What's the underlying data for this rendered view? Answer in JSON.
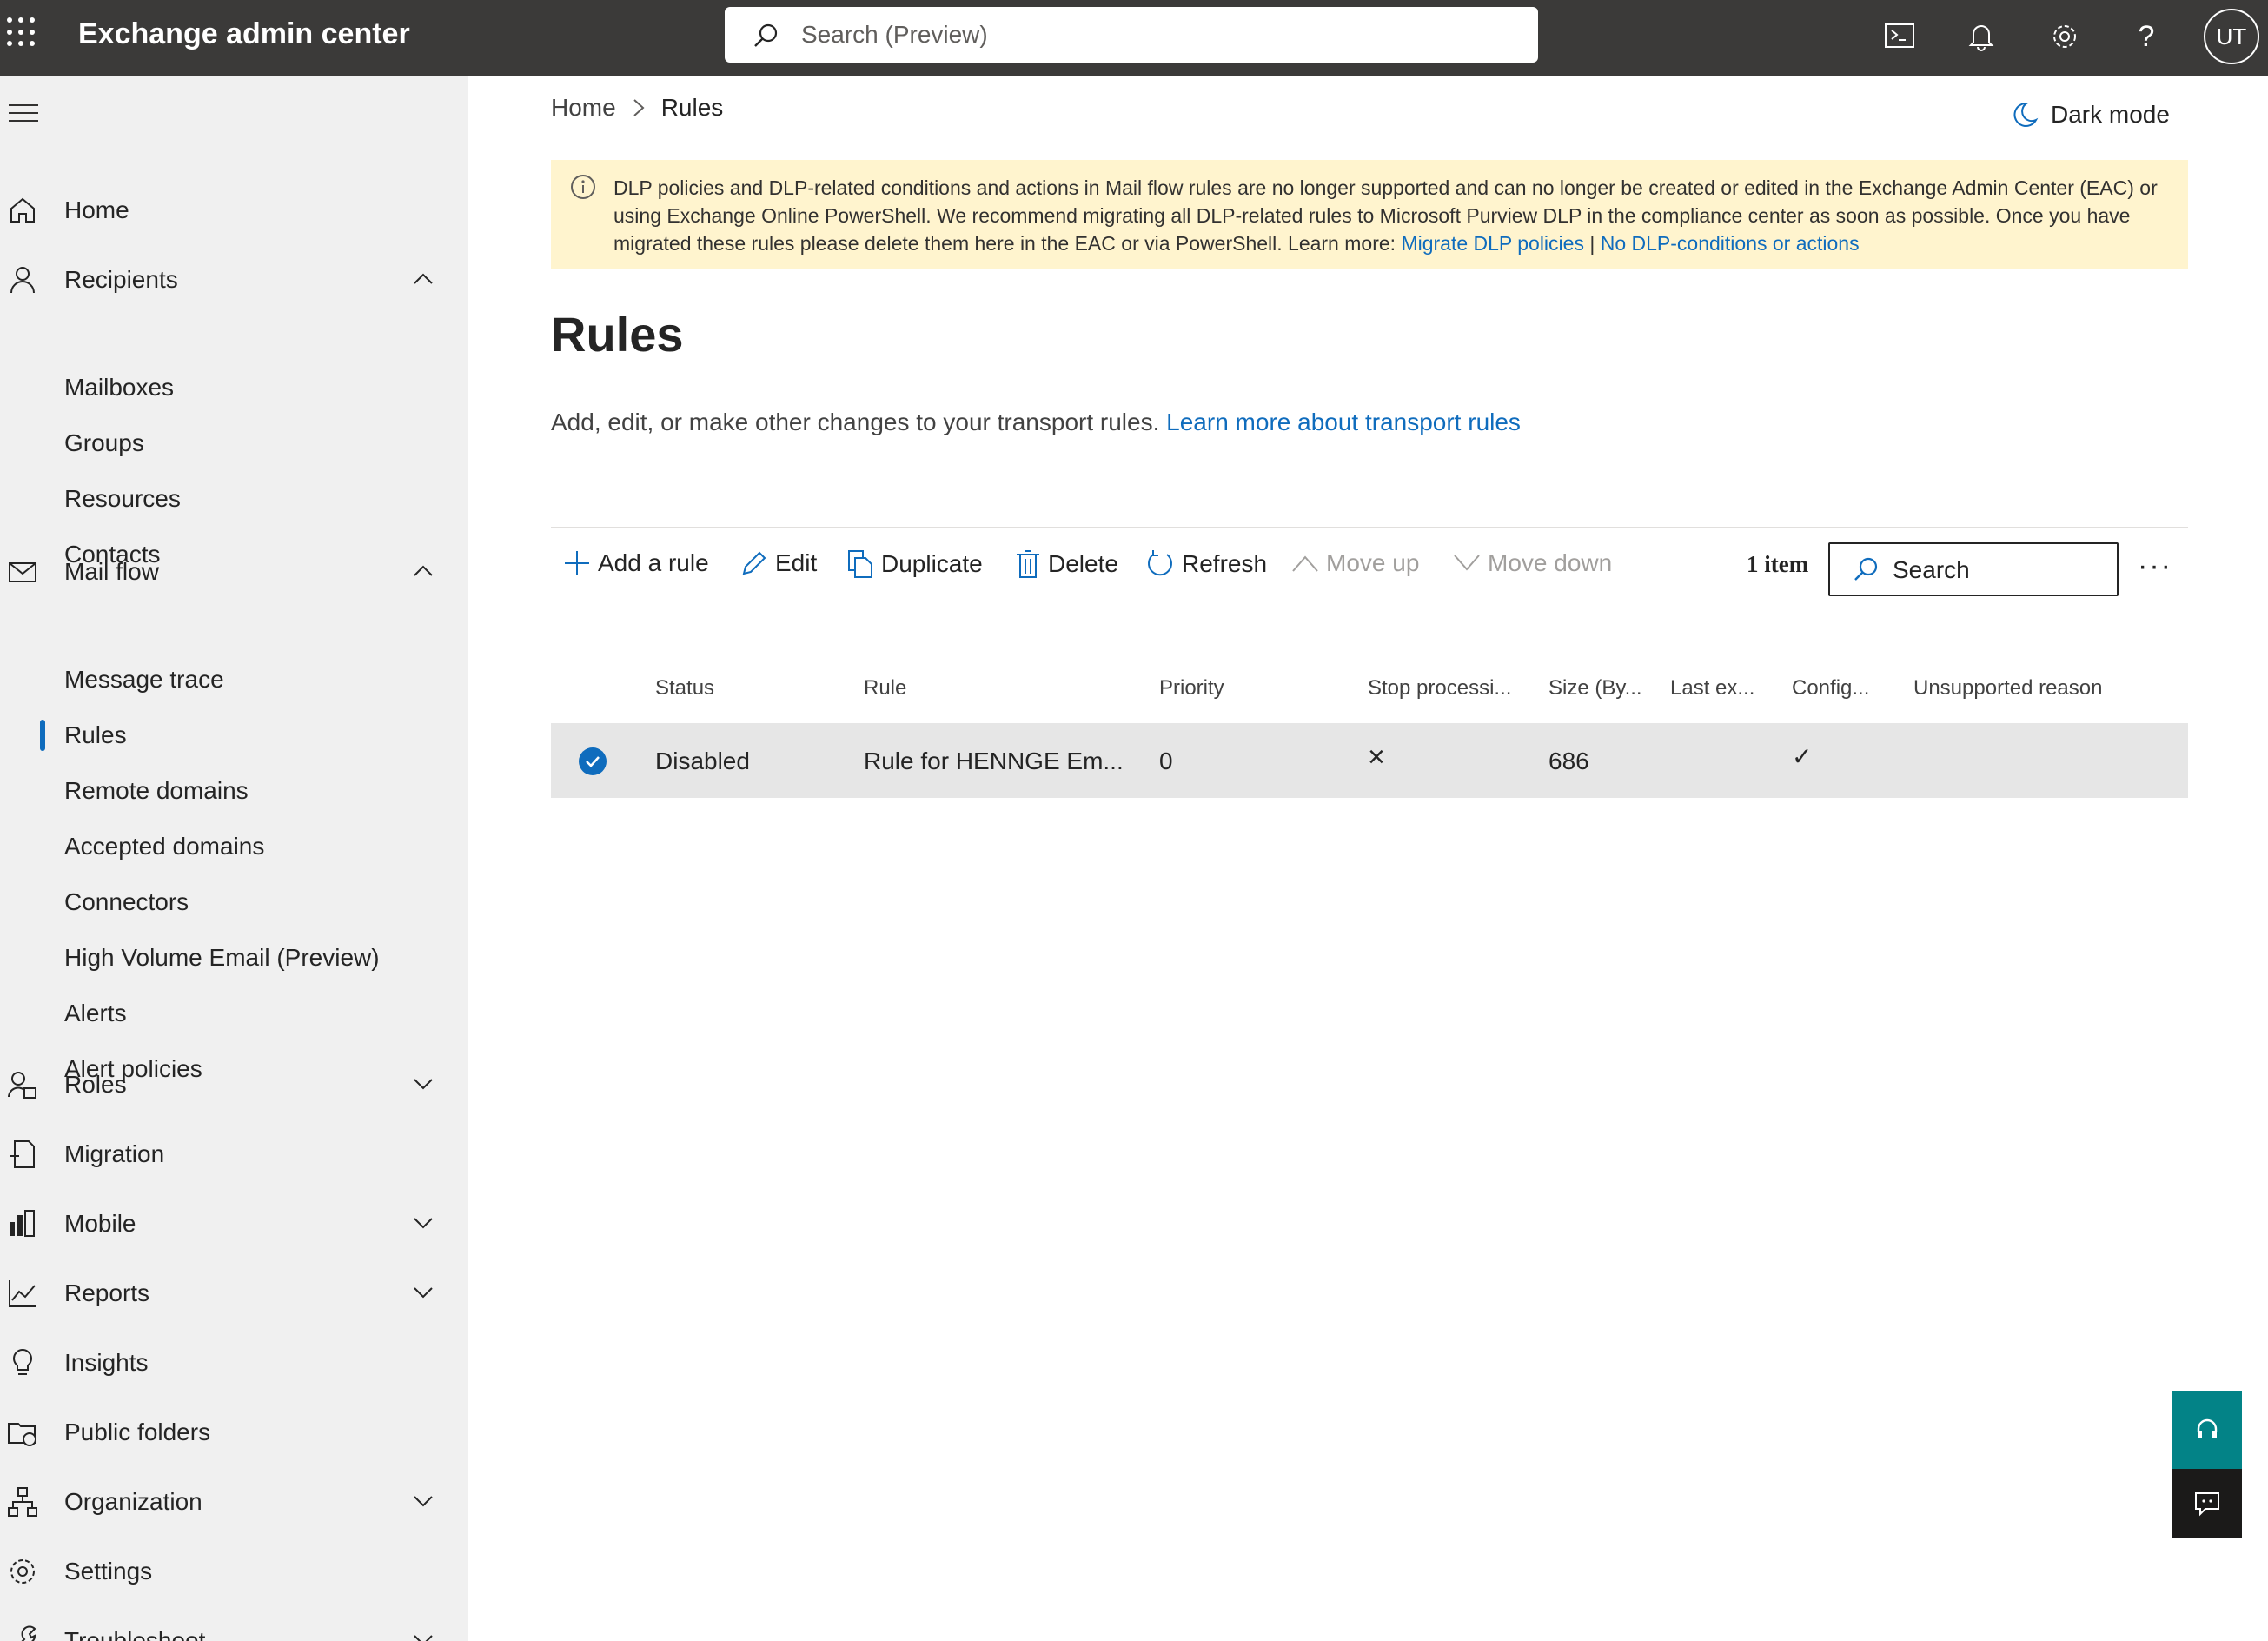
{
  "header": {
    "app_title": "Exchange admin center",
    "search_placeholder": "Search (Preview)",
    "avatar_initials": "UT"
  },
  "sidebar": {
    "items": [
      {
        "label": "Home"
      },
      {
        "label": "Recipients"
      },
      {
        "label": "Mailboxes"
      },
      {
        "label": "Groups"
      },
      {
        "label": "Resources"
      },
      {
        "label": "Contacts"
      },
      {
        "label": "Mail flow"
      },
      {
        "label": "Message trace"
      },
      {
        "label": "Rules"
      },
      {
        "label": "Remote domains"
      },
      {
        "label": "Accepted domains"
      },
      {
        "label": "Connectors"
      },
      {
        "label": "High Volume Email (Preview)"
      },
      {
        "label": "Alerts"
      },
      {
        "label": "Alert policies"
      },
      {
        "label": "Roles"
      },
      {
        "label": "Migration"
      },
      {
        "label": "Mobile"
      },
      {
        "label": "Reports"
      },
      {
        "label": "Insights"
      },
      {
        "label": "Public folders"
      },
      {
        "label": "Organization"
      },
      {
        "label": "Settings"
      },
      {
        "label": "Troubleshoot"
      }
    ]
  },
  "breadcrumb": {
    "home": "Home",
    "current": "Rules"
  },
  "dark_mode_label": "Dark mode",
  "banner": {
    "text": "DLP policies and DLP-related conditions and actions in Mail flow rules are no longer supported and can no longer be created or edited in the Exchange Admin Center (EAC) or using Exchange Online PowerShell. We recommend migrating all DLP-related rules to Microsoft Purview DLP in the compliance center as soon as possible. Once you have migrated these rules please delete them here in the EAC or via PowerShell. Learn more: ",
    "link1": "Migrate DLP policies",
    "separator": " | ",
    "link2": "No DLP-conditions or actions"
  },
  "page": {
    "title": "Rules",
    "description": "Add, edit, or make other changes to your transport rules. ",
    "learn_more": "Learn more about transport rules"
  },
  "toolbar": {
    "add": "Add a rule",
    "edit": "Edit",
    "duplicate": "Duplicate",
    "delete": "Delete",
    "refresh": "Refresh",
    "move_up": "Move up",
    "move_down": "Move down",
    "item_count": "1 item",
    "search_placeholder": "Search",
    "more": "···"
  },
  "table": {
    "columns": [
      "Status",
      "Rule",
      "Priority",
      "Stop processi...",
      "Size (By...",
      "Last ex...",
      "Config...",
      "Unsupported reason"
    ],
    "rows": [
      {
        "status": "Disabled",
        "rule": "Rule for HENNGE Em...",
        "priority": "0",
        "stop_processing": "×",
        "size": "686",
        "last_executed": "",
        "config": "✓",
        "unsupported_reason": ""
      }
    ]
  },
  "colors": {
    "topbar": "#3b3a39",
    "sidebar": "#f0f0f0",
    "accent": "#0f6cbd",
    "banner": "#fff4ce",
    "help": "#038387"
  }
}
